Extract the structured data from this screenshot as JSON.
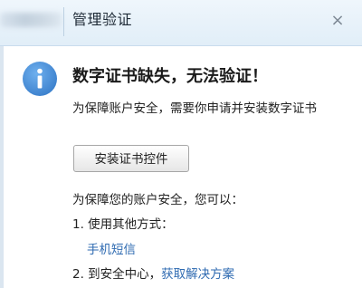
{
  "dialog": {
    "title": "管理验证",
    "close_glyph": "×",
    "heading": "数字证书缺失，无法验证！",
    "message": "为保障账户安全，需要你申请并安装数字证书",
    "install_button": "安装证书控件",
    "intro": "为保障您的账户安全，您可以：",
    "option1_text": "1. 使用其他方式：",
    "sms_link": "手机短信",
    "option2_prefix": "2. 到安全中心，",
    "option2_link": "获取解决方案",
    "icon": "info-icon",
    "colors": {
      "accent": "#4a90d9",
      "link": "#2e6ab1",
      "titlebar": "#e6f0f9"
    }
  }
}
